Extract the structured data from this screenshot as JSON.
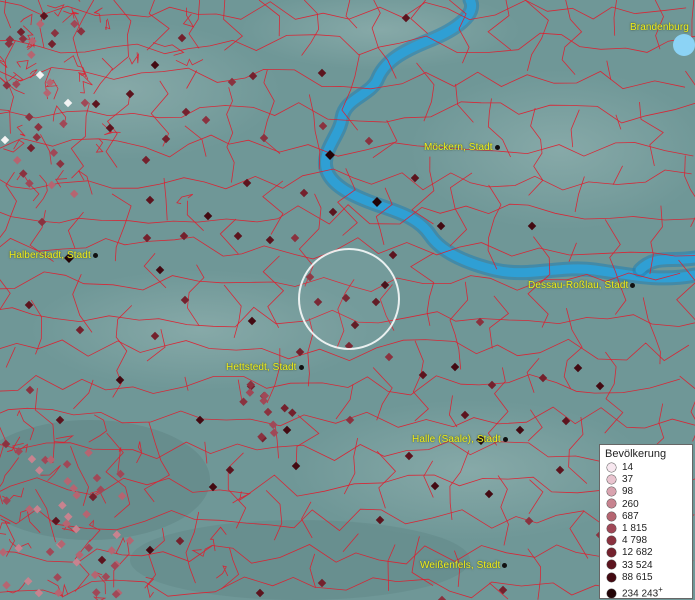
{
  "map": {
    "colors": {
      "land": "#6f9797",
      "water": "#2b93c9",
      "boundary": "#e01c2c"
    },
    "cities": [
      {
        "name": "Brandenburg"
      },
      {
        "name": "Möckern, Stadt"
      },
      {
        "name": "Halberstadt, Stadt"
      },
      {
        "name": "Dessau-Roßlau, Stadt"
      },
      {
        "name": "Hettstedt, Stadt"
      },
      {
        "name": "Halle (Saale), Stadt"
      },
      {
        "name": "Weißenfels, Stadt"
      }
    ]
  },
  "legend": {
    "title": "Bevölkerung",
    "items": [
      {
        "label": "14",
        "color": "#f7e7ef"
      },
      {
        "label": "37",
        "color": "#e9c4cf"
      },
      {
        "label": "98",
        "color": "#d8a3af"
      },
      {
        "label": "260",
        "color": "#c7838f"
      },
      {
        "label": "687",
        "color": "#b56571"
      },
      {
        "label": "1 815",
        "color": "#a04857"
      },
      {
        "label": "4 798",
        "color": "#8a323f"
      },
      {
        "label": "12 682",
        "color": "#74212d"
      },
      {
        "label": "33 524",
        "color": "#5c141e"
      },
      {
        "label": "88 615",
        "color": "#430a12"
      },
      {
        "label": "234 243",
        "suffix": "+",
        "color": "#220306"
      }
    ]
  }
}
